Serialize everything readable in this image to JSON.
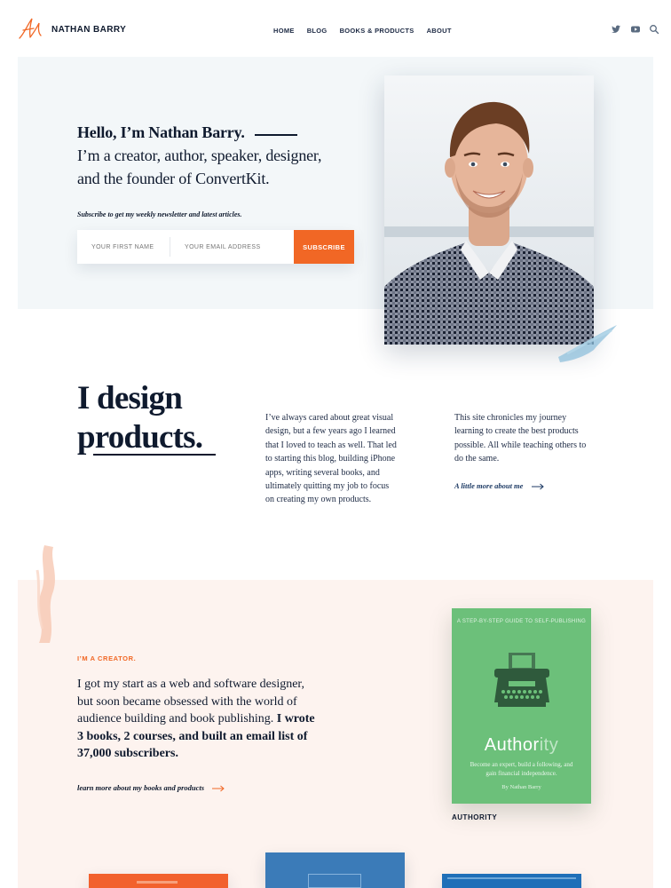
{
  "header": {
    "brand": "NATHAN BARRY",
    "nav": [
      "HOME",
      "BLOG",
      "BOOKS & PRODUCTS",
      "ABOUT"
    ],
    "icons": [
      "twitter-icon",
      "youtube-icon",
      "search-icon"
    ]
  },
  "hero": {
    "hello": "Hello, I’m Nathan Barry.",
    "line1": "I’m a creator, author, speaker, designer,",
    "line2": "and the founder of ConvertKit.",
    "subscribe_prompt": "Subscribe to get my weekly newsletter and latest articles.",
    "first_name_placeholder": "YOUR FIRST NAME",
    "email_placeholder": "YOUR EMAIL ADDRESS",
    "subscribe_button": "SUBSCRIBE"
  },
  "design": {
    "title_line1": "I design",
    "title_line2": "products.",
    "col1": [
      "I’ve always cared about great visual",
      "design, but a few years ago I learned",
      "that I loved to teach as well. That led",
      "to starting this blog, building iPhone",
      "apps, writing several books, and",
      "ultimately quitting my job to focus",
      "on creating my own products."
    ],
    "col2": [
      "This site chronicles my journey",
      "learning to create the best products",
      "possible. All while teaching others to",
      "do the same."
    ],
    "link": "A little more about me"
  },
  "creator": {
    "eyebrow": "I’M A CREATOR.",
    "para_plain": "I got my start as a web and software designer, but soon became obsessed with the world of audience building and book publishing. ",
    "para_bold": "I wrote 3 books, 2 courses, and built an email list of 37,000 subscribers.",
    "link": "learn more about my books and products",
    "book": {
      "top": "A STEP-BY-STEP GUIDE TO SELF-PUBLISHING",
      "title_a": "Author",
      "title_b": "ity",
      "desc": "Become an expert, build a following, and gain financial independence.",
      "author": "By Nathan Barry",
      "caption": "AUTHORITY"
    }
  },
  "colors": {
    "accent": "#f16725",
    "navy": "#0f1a2e",
    "hero_bg": "#f3f7f9",
    "creator_bg": "#fdf3ef",
    "book_green": "#6cc07a"
  }
}
